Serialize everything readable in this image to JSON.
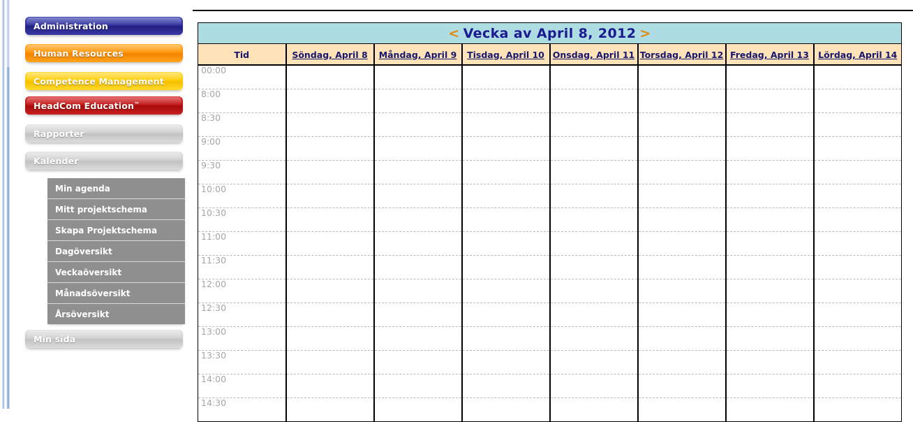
{
  "sidebar": {
    "main_items": [
      {
        "label": "Administration",
        "color": "#2e2f9e",
        "style": "nav-blue"
      },
      {
        "label": "Human Resources",
        "color": "#ff9405",
        "style": "nav-orange"
      },
      {
        "label": "Competence Management",
        "color": "#ffcc00",
        "style": "nav-yellow"
      },
      {
        "label": "HeadCom Education",
        "color": "#c01414",
        "style": "nav-red",
        "trademark": "™"
      },
      {
        "label": "Rapporter",
        "color": "#cfcfcf",
        "style": "nav-gray"
      },
      {
        "label": "Kalender",
        "color": "#cfcfcf",
        "style": "nav-gray"
      },
      {
        "label": "Min sida",
        "color": "#cfcfcf",
        "style": "nav-gray"
      }
    ],
    "submenu": {
      "parent": "Kalender",
      "items": [
        {
          "label": "Min agenda"
        },
        {
          "label": "Mitt projektschema"
        },
        {
          "label": "Skapa Projektschema"
        },
        {
          "label": "Dagöversikt"
        },
        {
          "label": "Veckaöversikt"
        },
        {
          "label": "Månadsöversikt"
        },
        {
          "label": "Årsöversikt"
        }
      ]
    }
  },
  "calendar": {
    "title": "Vecka av April 8, 2012",
    "prev_arrow": "<",
    "next_arrow": ">",
    "title_bg": "#addde3",
    "title_color": "#1b1b8f",
    "arrow_color": "#e08a14",
    "header_bg": "#ffe3b8",
    "columns": [
      {
        "label": "Tid",
        "link": false
      },
      {
        "label": "Söndag, April 8",
        "link": true
      },
      {
        "label": "Måndag, April 9",
        "link": true
      },
      {
        "label": "Tisdag, April 10",
        "link": true
      },
      {
        "label": "Onsdag, April 11",
        "link": true
      },
      {
        "label": "Torsdag, April 12",
        "link": true
      },
      {
        "label": "Fredag, April 13",
        "link": true
      },
      {
        "label": "Lördag, April 14",
        "link": true
      }
    ],
    "time_slots": [
      "00:00",
      "8:00",
      "8:30",
      "9:00",
      "9:30",
      "10:00",
      "10:30",
      "11:00",
      "11:30",
      "12:00",
      "12:30",
      "13:00",
      "13:30",
      "14:00",
      "14:30"
    ],
    "events": []
  }
}
